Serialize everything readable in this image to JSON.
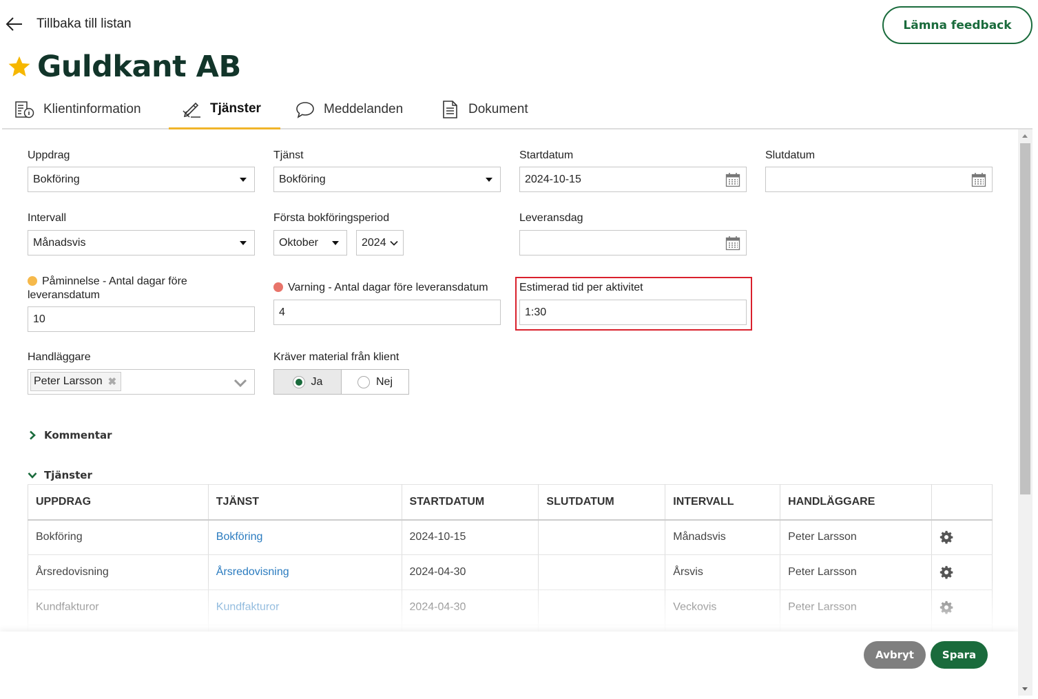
{
  "header": {
    "back_label": "Tillbaka till listan",
    "feedback_label": "Lämna feedback",
    "title": "Guldkant AB"
  },
  "tabs": [
    {
      "label": "Klientinformation",
      "icon": "client-info-icon"
    },
    {
      "label": "Tjänster",
      "icon": "pen-ruler-icon",
      "active": true
    },
    {
      "label": "Meddelanden",
      "icon": "speech-bubble-icon"
    },
    {
      "label": "Dokument",
      "icon": "document-icon"
    }
  ],
  "form": {
    "uppdrag": {
      "label": "Uppdrag",
      "value": "Bokföring"
    },
    "tjanst": {
      "label": "Tjänst",
      "value": "Bokföring"
    },
    "startdatum": {
      "label": "Startdatum",
      "value": "2024-10-15"
    },
    "slutdatum": {
      "label": "Slutdatum",
      "value": ""
    },
    "intervall": {
      "label": "Intervall",
      "value": "Månadsvis"
    },
    "forsta_period": {
      "label": "Första bokföringsperiod",
      "month": "Oktober",
      "year": "2024"
    },
    "leveransdag": {
      "label": "Leveransdag",
      "value": ""
    },
    "paminnelse": {
      "label": "Påminnelse - Antal dagar före leveransdatum",
      "value": "10",
      "dot_color": "#f6b94b"
    },
    "varning": {
      "label": "Varning - Antal dagar före leveransdatum",
      "value": "4",
      "dot_color": "#e8746a"
    },
    "estimerad_tid": {
      "label": "Estimerad tid per aktivitet",
      "value": "1:30"
    },
    "handlaggare": {
      "label": "Handläggare",
      "chip": "Peter Larsson"
    },
    "kraver_material": {
      "label": "Kräver material från klient",
      "options": [
        "Ja",
        "Nej"
      ],
      "selected": "Ja"
    }
  },
  "sections": {
    "kommentar": "Kommentar",
    "tjanster": "Tjänster"
  },
  "table": {
    "headers": [
      "UPPDRAG",
      "TJÄNST",
      "STARTDATUM",
      "SLUTDATUM",
      "INTERVALL",
      "HANDLÄGGARE",
      ""
    ],
    "rows": [
      {
        "uppdrag": "Bokföring",
        "tjanst": "Bokföring",
        "start": "2024-10-15",
        "slut": "",
        "intervall": "Månadsvis",
        "handlaggare": "Peter Larsson"
      },
      {
        "uppdrag": "Årsredovisning",
        "tjanst": "Årsredovisning",
        "start": "2024-04-30",
        "slut": "",
        "intervall": "Årsvis",
        "handlaggare": "Peter Larsson"
      },
      {
        "uppdrag": "Kundfakturor",
        "tjanst": "Kundfakturor",
        "start": "2024-04-30",
        "slut": "",
        "intervall": "Veckovis",
        "handlaggare": "Peter Larsson"
      }
    ]
  },
  "footer": {
    "cancel_label": "Avbryt",
    "save_label": "Spara"
  },
  "colors": {
    "brand_green": "#1a6b3c",
    "title_green": "#12352a",
    "tab_underline": "#f0b429",
    "link_blue": "#2a7bbf",
    "highlight_red": "#d9202c"
  }
}
